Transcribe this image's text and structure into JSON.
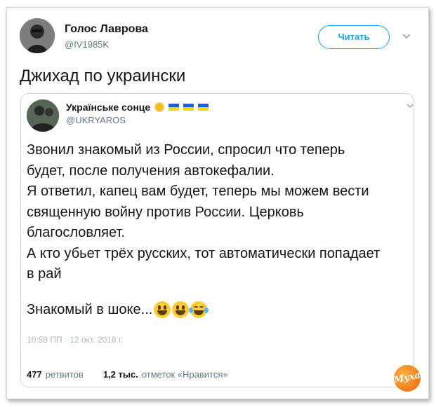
{
  "tweet": {
    "author_name": "Голос Лаврова",
    "author_handle": "@IV1985K",
    "follow_label": "Читать",
    "text": "Джихад по украински"
  },
  "quoted": {
    "author_name": "Українське сонце",
    "author_handle": "@UKRYAROS",
    "body_lines": [
      "Звонил знакомый из России, спросил что теперь",
      "будет, после получения автокефалии.",
      "Я ответил, капец вам будет, теперь мы можем вести",
      "священную войну против России.  Церковь",
      "благословляет.",
      "А кто убьет трёх русских, тот автоматически попадает",
      "в рай"
    ],
    "final_line": "Знакомый в шоке...",
    "timestamp": "10:59 ПП · 12 окт. 2018 г."
  },
  "stats": {
    "retweets_count": "477",
    "retweets_label": "ретвитов",
    "likes_count": "1,2 тыс.",
    "likes_label": "отметок «Нравится»"
  },
  "icons": {
    "name_emoji": "sun-emoji",
    "flags": [
      "ukraine-flag",
      "ukraine-flag",
      "ukraine-flag"
    ],
    "final_emojis": [
      "grinning-face",
      "grinning-face",
      "joy-face"
    ]
  },
  "colors": {
    "accent": "#1da1f2",
    "secondary_text": "#657786",
    "flag_blue": "#1d5fcf",
    "flag_yellow": "#ffd500"
  },
  "watermark": "Муха"
}
